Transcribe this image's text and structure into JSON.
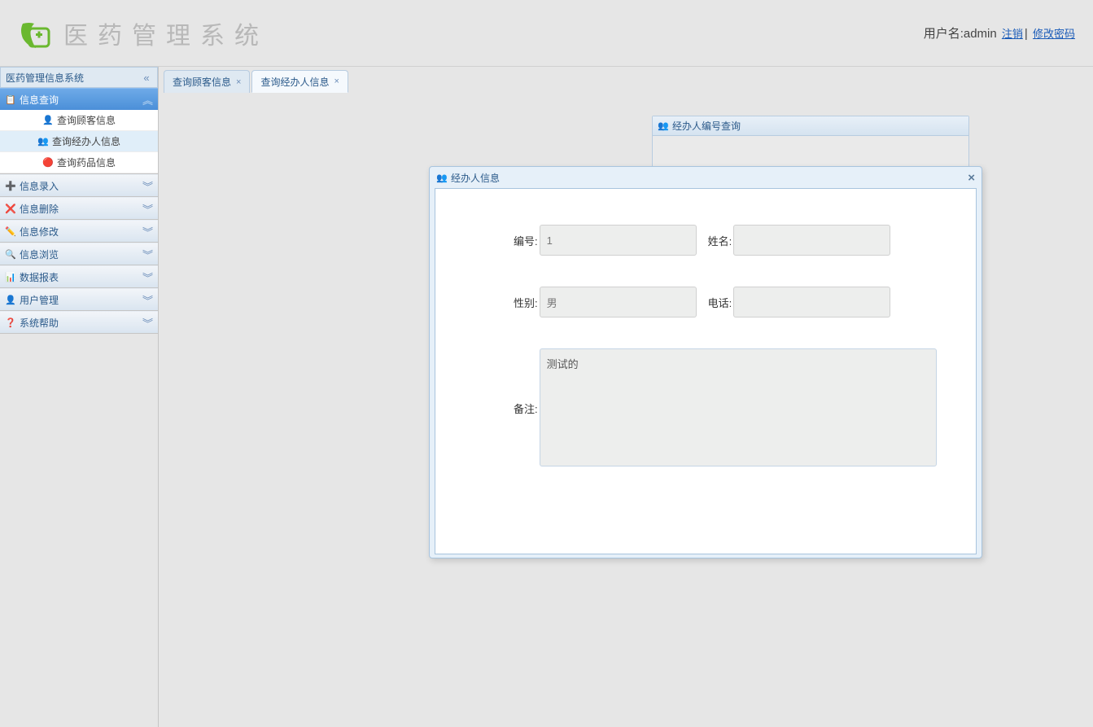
{
  "header": {
    "app_title": "医药管理系统",
    "user_label": "用户名:",
    "username": "admin",
    "logout_link": "注销",
    "change_pw_link": "修改密码",
    "separator": "|"
  },
  "sidebar": {
    "title": "医药管理信息系统",
    "groups": [
      {
        "label": "信息查询",
        "icon": "📋",
        "active": true,
        "expanded": true,
        "items": [
          {
            "label": "查询顾客信息",
            "icon": "👤"
          },
          {
            "label": "查询经办人信息",
            "icon": "👥",
            "selected": true
          },
          {
            "label": "查询药品信息",
            "icon": "🔴"
          }
        ]
      },
      {
        "label": "信息录入",
        "icon": "➕"
      },
      {
        "label": "信息删除",
        "icon": "❌"
      },
      {
        "label": "信息修改",
        "icon": "✏️"
      },
      {
        "label": "信息浏览",
        "icon": "🔍"
      },
      {
        "label": "数据报表",
        "icon": "📊"
      },
      {
        "label": "用户管理",
        "icon": "👤"
      },
      {
        "label": "系统帮助",
        "icon": "❓"
      }
    ]
  },
  "tabs": [
    {
      "label": "查询顾客信息",
      "active": false
    },
    {
      "label": "查询经办人信息",
      "active": true
    }
  ],
  "bg_panel": {
    "title": "经办人编号查询"
  },
  "modal": {
    "title": "经办人信息",
    "fields": {
      "id_label": "编号:",
      "id_value": "1",
      "name_label": "姓名:",
      "name_value": "",
      "gender_label": "性别:",
      "gender_value": "男",
      "phone_label": "电话:",
      "phone_value": "",
      "remark_label": "备注:",
      "remark_value": "测试的"
    }
  }
}
